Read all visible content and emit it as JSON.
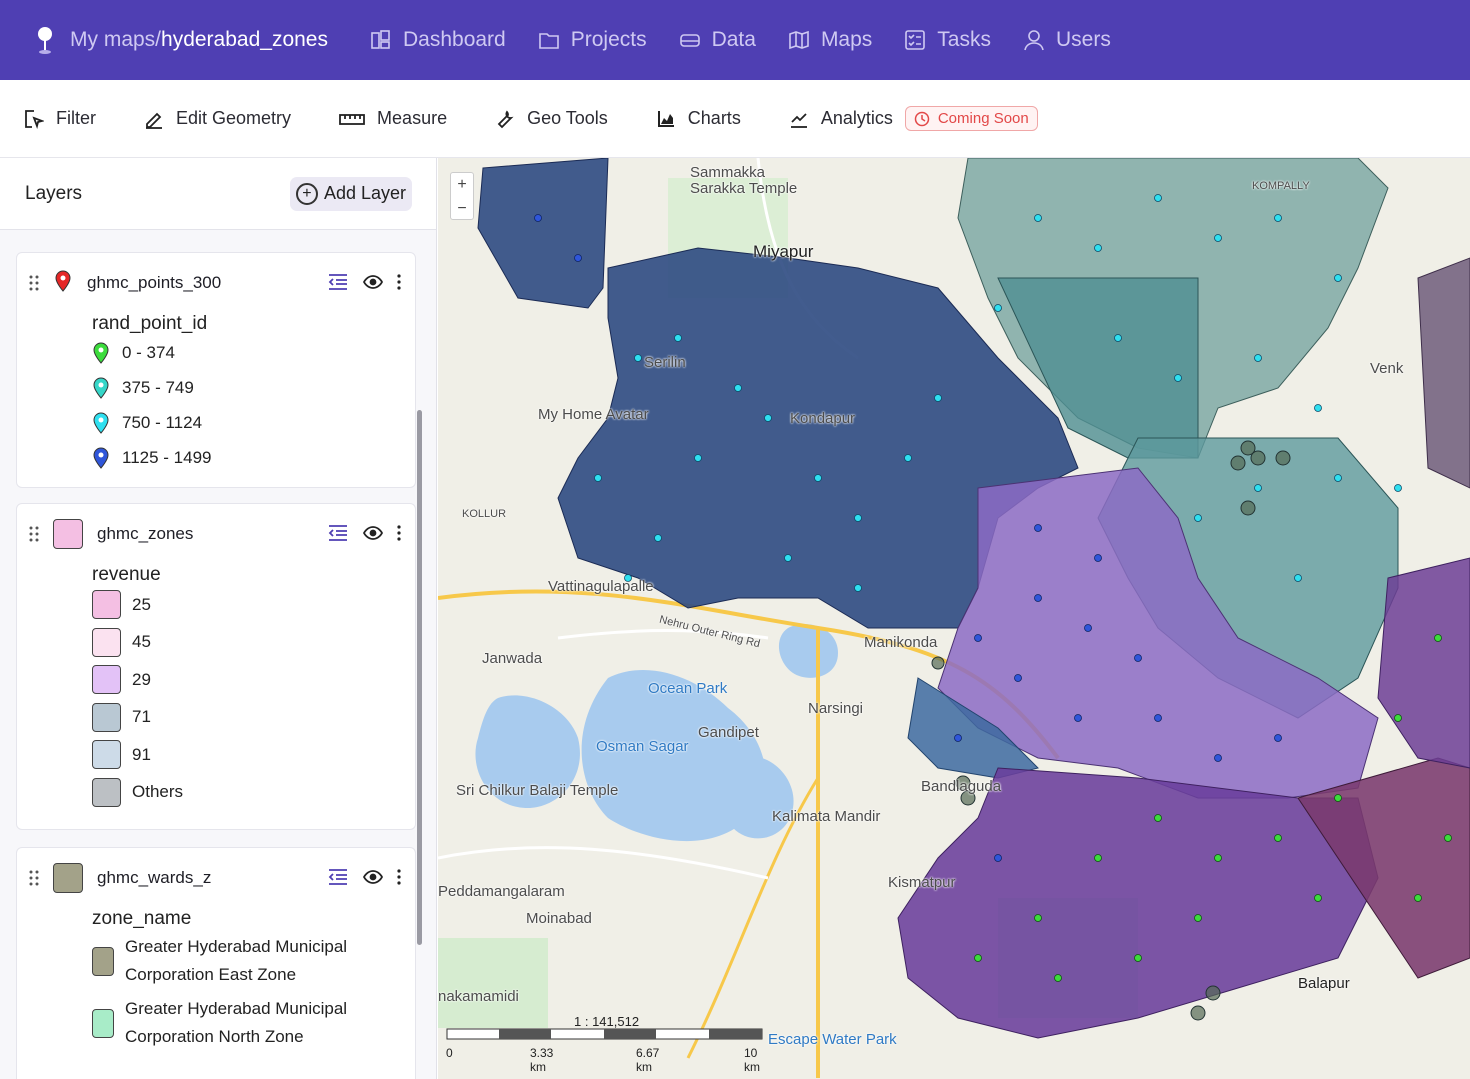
{
  "nav": {
    "crumb_root": "My maps/",
    "crumb_current": "hyderabad_zones",
    "items": [
      {
        "label": "Dashboard",
        "icon": "dashboard-icon"
      },
      {
        "label": "Projects",
        "icon": "folder-icon"
      },
      {
        "label": "Data",
        "icon": "database-icon"
      },
      {
        "label": "Maps",
        "icon": "map-icon"
      },
      {
        "label": "Tasks",
        "icon": "tasks-icon"
      },
      {
        "label": "Users",
        "icon": "user-icon"
      }
    ]
  },
  "toolbar": {
    "filter": "Filter",
    "edit_geometry": "Edit Geometry",
    "measure": "Measure",
    "geo_tools": "Geo Tools",
    "charts": "Charts",
    "analytics": "Analytics",
    "badge": "Coming Soon"
  },
  "sidebar": {
    "title": "Layers",
    "add_layer": "Add Layer",
    "layers": [
      {
        "name": "ghmc_points_300",
        "legend_title": "rand_point_id",
        "items": [
          {
            "label": "0 - 374",
            "color": "#3cdc3c"
          },
          {
            "label": "375 - 749",
            "color": "#35d6c8"
          },
          {
            "label": "750 - 1124",
            "color": "#2fe0f0"
          },
          {
            "label": "1125 - 1499",
            "color": "#2f56d9"
          }
        ]
      },
      {
        "name": "ghmc_zones",
        "swatch": "#f4bfe3",
        "legend_title": "revenue",
        "items": [
          {
            "label": "25",
            "color": "#f4bfe3"
          },
          {
            "label": "45",
            "color": "#fbe2f0"
          },
          {
            "label": "29",
            "color": "#e3c2f7"
          },
          {
            "label": "71",
            "color": "#b9c8d3"
          },
          {
            "label": "91",
            "color": "#cddbe8"
          },
          {
            "label": "Others",
            "color": "#bcc0c4"
          }
        ]
      },
      {
        "name": "ghmc_wards_z",
        "swatch": "#a3a289",
        "legend_title": "zone_name",
        "items": [
          {
            "label_1": "Greater Hyderabad Municipal",
            "label_2": "Corporation East Zone",
            "color": "#a3a289"
          },
          {
            "label_1": "Greater Hyderabad Municipal",
            "label_2": "Corporation North Zone",
            "color": "#a8ecc8"
          }
        ]
      }
    ]
  },
  "map": {
    "zoom_in": "+",
    "zoom_out": "−",
    "scale_ratio": "1 : 141,512",
    "scale_ticks": [
      "0",
      "3.33 km",
      "6.67 km",
      "10 km"
    ],
    "labels": {
      "sammakka": "Sammakka",
      "sarakka": "Sarakka Temple",
      "miyapur": "Miyapur",
      "serilingampally": "Serilin",
      "my_home": "My Home Avatar",
      "kondapur": "Kondapur",
      "vattinagulapalle": "Vattinagulapalle",
      "manikonda": "Manikonda",
      "janwada": "Janwada",
      "ocean_park": "Ocean Park",
      "osman_sagar": "Osman Sagar",
      "gandipet": "Gandipet",
      "narsingi": "Narsingi",
      "chilkur": "Sri Chilkur Balaji Temple",
      "kalimata": "Kalimata Mandir",
      "bandlaguda": "Bandlaguda",
      "kismatpur": "Kismatpur",
      "peddamangalaram": "Peddamangalaram",
      "moinabad": "Moinabad",
      "nakamamidi": "nakamamidi",
      "escape": "Escape Water Park",
      "balapur": "Balapur",
      "kompally": "KOMPALLY",
      "kollur": "KOLLUR",
      "orr": "Nehru Outer Ring Rd",
      "venk": "Venk"
    },
    "colors": {
      "west_zone": "#2e4a82",
      "north_zone": "#4f8f92",
      "lightnorth_zone": "#7fa9a5",
      "central_zone": "#8c6bc4",
      "south_zone": "#6a3f9c",
      "southeast_zone": "#7a3a6e"
    }
  }
}
